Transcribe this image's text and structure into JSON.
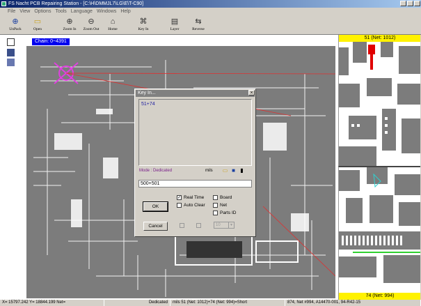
{
  "app": {
    "title": "FS Nacht PCB Repairing Station - [C:\\H\\DMMJL7\\LG\\E\\T-C90]"
  },
  "menu": [
    "File",
    "View",
    "Options",
    "Tools",
    "Language",
    "Windows",
    "Help"
  ],
  "toolbar": [
    {
      "label": "UnPack",
      "icon": "unpack-icon"
    },
    {
      "label": "Open",
      "icon": "open-folder-icon"
    },
    {
      "label": "Zoom In",
      "icon": "zoom-in-icon"
    },
    {
      "label": "Zoom Out",
      "icon": "zoom-out-icon"
    },
    {
      "label": "Home",
      "icon": "home-icon"
    },
    {
      "label": "Key In",
      "icon": "key-in-icon"
    },
    {
      "label": "Layer",
      "icon": "layer-icon"
    },
    {
      "label": "Reverse",
      "icon": "reverse-icon"
    }
  ],
  "canvas": {
    "coord_label": "Chain: 0~4391"
  },
  "panes": {
    "top_label": "51 (Net: 1012)",
    "bottom_label": "74 (Net: 994)"
  },
  "dialog": {
    "title": "Key In...",
    "list_items": [
      "51+74"
    ],
    "mode_text": "Mode : Dedicated",
    "unit_text": "mils",
    "input_value": "500+501",
    "checkboxes": {
      "real_time": {
        "label": "Real Time",
        "checked": true
      },
      "auto_clear": {
        "label": "Auto Clear",
        "checked": false
      },
      "board": {
        "label": "Board",
        "checked": false
      },
      "net": {
        "label": "Net",
        "checked": false
      },
      "parts_id": {
        "label": "Parts ID",
        "checked": false
      }
    },
    "ok_label": "OK",
    "cancel_label": "Cancel",
    "spin_value": "10"
  },
  "status": {
    "coords": "X= 15797.242  Y= 18844.199 Net=",
    "mode": "Dedicated",
    "measure": "mils  51 (Net: 1012)+74 (Net: 994)=Short",
    "part": "874, Net #994, A14470-001, 94-R42-15"
  },
  "colors": {
    "title_gradient_start": "#0a246a",
    "label_yellow": "#fff200",
    "board_gray": "#7c7c7c",
    "highlight_red": "#e00000",
    "crosshair_magenta": "#e040e0"
  }
}
